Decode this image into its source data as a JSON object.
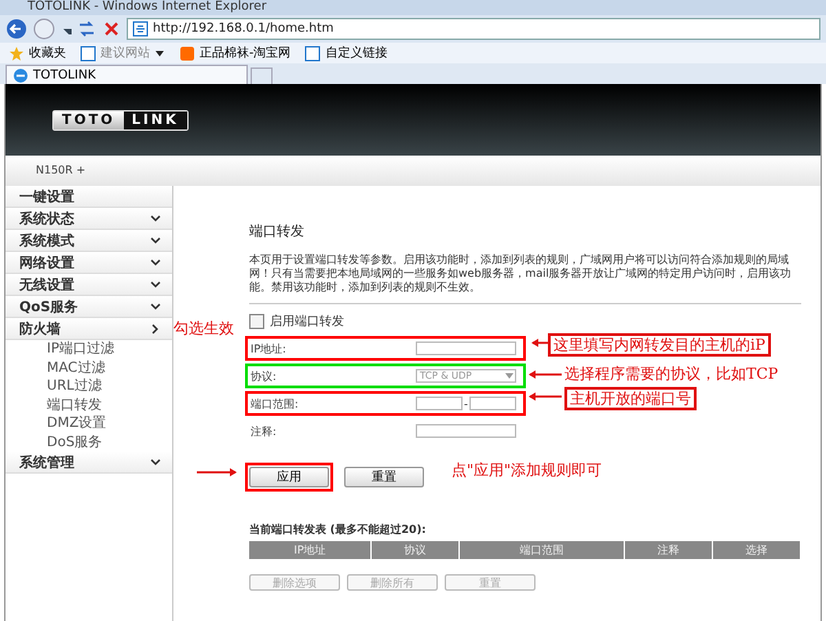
{
  "window": {
    "title": "TOTOLINK - Windows Internet Explorer"
  },
  "address_bar": {
    "url": "http://192.168.0.1/home.htm"
  },
  "favorites_bar": [
    {
      "label": "收藏夹",
      "kind": "star"
    },
    {
      "label": "建议网站",
      "kind": "dropdown"
    },
    {
      "label": "正品棉袜-淘宝网",
      "kind": "shop"
    },
    {
      "label": "自定义链接",
      "kind": "page"
    }
  ],
  "tab": {
    "title": "TOTOLINK"
  },
  "logo": {
    "left": "TOTO",
    "right": "LINK"
  },
  "model": "N150R +",
  "sidebar": [
    {
      "label": "一键设置",
      "kind": "link"
    },
    {
      "label": "系统状态",
      "kind": "group",
      "expanded": false
    },
    {
      "label": "系统模式",
      "kind": "group",
      "expanded": false
    },
    {
      "label": "网络设置",
      "kind": "group",
      "expanded": false
    },
    {
      "label": "无线设置",
      "kind": "group",
      "expanded": false
    },
    {
      "label": "QoS服务",
      "kind": "group",
      "expanded": false
    },
    {
      "label": "防火墙",
      "kind": "group",
      "expanded": true,
      "children": [
        {
          "label": "IP端口过滤"
        },
        {
          "label": "MAC过滤"
        },
        {
          "label": "URL过滤"
        },
        {
          "label": "端口转发"
        },
        {
          "label": "DMZ设置"
        },
        {
          "label": "DoS服务"
        }
      ]
    },
    {
      "label": "系统管理",
      "kind": "group",
      "expanded": false
    }
  ],
  "content": {
    "heading": "端口转发",
    "description": "本页用于设置端口转发等参数。启用该功能时，添加到列表的规则，广域网用户将可以访问符合添加规则的局域网！只有当需要把本地局域网的一些服务如web服务器，mail服务器开放让广域网的特定用户访问时，启用该功能。禁用该功能时，添加到列表的规则不生效。",
    "enable": {
      "label": "启用端口转发",
      "checked": false
    },
    "fields": [
      {
        "kind": "text",
        "label": "IP地址:",
        "color": "#ff0000"
      },
      {
        "kind": "select",
        "label": "协议:",
        "value": "TCP & UDP",
        "color": "#00dd00"
      },
      {
        "kind": "range",
        "label": "端口范围:",
        "separator": "-",
        "color": "#ff0000"
      },
      {
        "kind": "text",
        "label": "注释:"
      }
    ],
    "buttons": [
      {
        "label": "应用",
        "color": "#ff0000"
      },
      {
        "label": "重置"
      }
    ],
    "table": {
      "title": "当前端口转发表 (最多不能超过20):",
      "columns": [
        "IP地址",
        "协议",
        "端口范围",
        "注释",
        "选择"
      ],
      "buttons": [
        {
          "label": "删除选项",
          "disabled": true
        },
        {
          "label": "删除所有",
          "disabled": true
        },
        {
          "label": "重置",
          "disabled": true
        }
      ]
    }
  },
  "annotations": [
    {
      "kind": "plain",
      "text": "勾选生效"
    },
    {
      "kind": "boxed",
      "text": "这里填写内网转发目的主机的iP"
    },
    {
      "kind": "plain",
      "text": "选择程序需要的协议，比如TCP"
    },
    {
      "kind": "boxed",
      "text": "主机开放的端口号"
    },
    {
      "kind": "plain",
      "text": "点\"应用\"添加规则即可"
    }
  ]
}
